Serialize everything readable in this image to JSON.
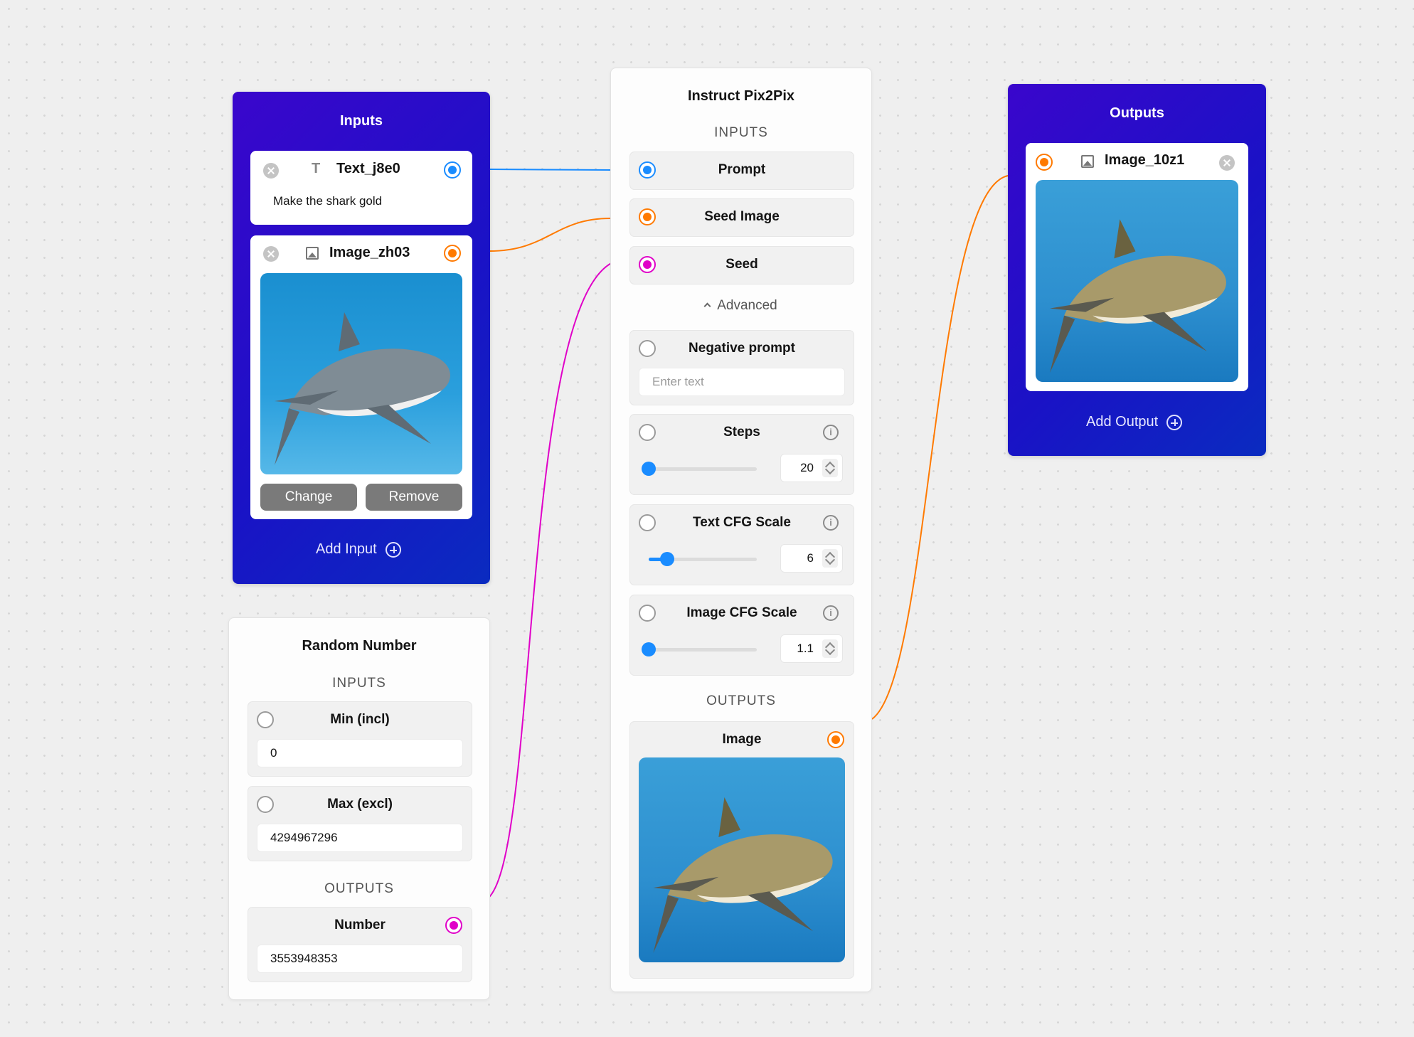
{
  "inputs_panel": {
    "title": "Inputs",
    "text_input": {
      "name": "Text_j8e0",
      "value": "Make the shark gold",
      "icon": "text-type-icon",
      "port_color": "#1a8cff"
    },
    "image_input": {
      "name": "Image_zh03",
      "icon": "image-icon",
      "port_color": "#ff7a00",
      "change_label": "Change",
      "remove_label": "Remove"
    },
    "add_label": "Add Input"
  },
  "random_number": {
    "title": "Random Number",
    "inputs_label": "INPUTS",
    "min_label": "Min (incl)",
    "min_value": "0",
    "max_label": "Max (excl)",
    "max_value": "4294967296",
    "outputs_label": "OUTPUTS",
    "number_label": "Number",
    "number_value": "3553948353"
  },
  "pix2pix": {
    "title": "Instruct Pix2Pix",
    "inputs_label": "INPUTS",
    "prompt_label": "Prompt",
    "seed_image_label": "Seed Image",
    "seed_label": "Seed",
    "advanced_label": "Advanced",
    "negative_prompt_label": "Negative prompt",
    "negative_prompt_placeholder": "Enter text",
    "steps": {
      "label": "Steps",
      "value": "20",
      "fraction": 0.0
    },
    "text_cfg": {
      "label": "Text CFG Scale",
      "value": "6",
      "fraction": 0.17
    },
    "image_cfg": {
      "label": "Image CFG Scale",
      "value": "1.1",
      "fraction": 0.0
    },
    "outputs_label": "OUTPUTS",
    "image_label": "Image"
  },
  "outputs_panel": {
    "title": "Outputs",
    "image_output": {
      "name": "Image_10z1",
      "icon": "image-icon"
    },
    "add_label": "Add Output"
  },
  "colors": {
    "text_port": "#1a8cff",
    "image_port": "#ff7a00",
    "number_port": "#e000c8",
    "panel_blue": "#1a12c6"
  }
}
